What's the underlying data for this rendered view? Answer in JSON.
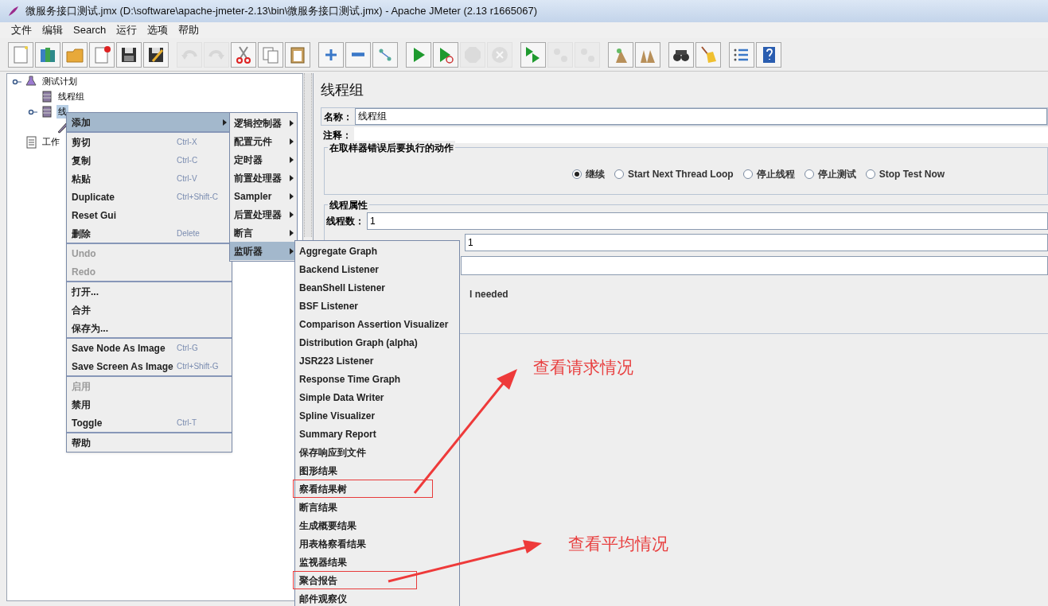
{
  "window": {
    "title": "微服务接口测试.jmx (D:\\software\\apache-jmeter-2.13\\bin\\微服务接口测试.jmx) - Apache JMeter (2.13 r1665067)"
  },
  "menu_bar": [
    "文件",
    "编辑",
    "Search",
    "运行",
    "选项",
    "帮助"
  ],
  "toolbar": [
    [
      {
        "kind": "new",
        "disabled": false
      },
      {
        "kind": "templates",
        "disabled": false
      },
      {
        "kind": "open",
        "disabled": false
      },
      {
        "kind": "close",
        "disabled": false
      },
      {
        "kind": "save",
        "disabled": false
      },
      {
        "kind": "save_as",
        "disabled": false
      }
    ],
    [
      {
        "kind": "undo",
        "disabled": true
      },
      {
        "kind": "redo",
        "disabled": true
      },
      {
        "kind": "cut",
        "disabled": false
      },
      {
        "kind": "copy",
        "disabled": false
      },
      {
        "kind": "paste",
        "disabled": false
      }
    ],
    [
      {
        "kind": "expand",
        "disabled": false
      },
      {
        "kind": "collapse",
        "disabled": false
      },
      {
        "kind": "toggle",
        "disabled": false
      }
    ],
    [
      {
        "kind": "start",
        "disabled": false
      },
      {
        "kind": "start_no_pause",
        "disabled": false
      },
      {
        "kind": "stop",
        "disabled": true
      },
      {
        "kind": "shutdown",
        "disabled": true
      }
    ],
    [
      {
        "kind": "remote_start",
        "disabled": false
      },
      {
        "kind": "remote_stop",
        "disabled": true
      },
      {
        "kind": "remote_shutdown",
        "disabled": true
      }
    ],
    [
      {
        "kind": "clear",
        "disabled": false
      },
      {
        "kind": "clear_all",
        "disabled": false
      }
    ],
    [
      {
        "kind": "search",
        "disabled": false
      },
      {
        "kind": "reset_search",
        "disabled": false
      }
    ],
    [
      {
        "kind": "functions",
        "disabled": false
      },
      {
        "kind": "help",
        "disabled": false
      }
    ]
  ],
  "tree": [
    {
      "label": "测试计划",
      "kind": "plan",
      "selected": false,
      "children": [
        {
          "label": "线程组",
          "kind": "thread",
          "selected": false
        },
        {
          "label": "线",
          "kind": "thread",
          "selected": true,
          "children": [
            {
              "kind": "sampler"
            }
          ]
        }
      ]
    },
    {
      "label": "工作",
      "kind": "workbench",
      "selected": false
    }
  ],
  "context_menu": [
    [
      {
        "label": "添加",
        "selected": true,
        "submenu": true,
        "disabled": false
      }
    ],
    [
      {
        "label": "剪切",
        "shortcut": "Ctrl-X",
        "selected": false,
        "submenu": false,
        "disabled": false
      },
      {
        "label": "复制",
        "shortcut": "Ctrl-C",
        "selected": false,
        "submenu": false,
        "disabled": false
      },
      {
        "label": "粘贴",
        "shortcut": "Ctrl-V",
        "selected": false,
        "submenu": false,
        "disabled": false
      },
      {
        "label": "Duplicate",
        "shortcut": "Ctrl+Shift-C",
        "selected": false,
        "submenu": false,
        "disabled": false
      },
      {
        "label": "Reset Gui",
        "selected": false,
        "submenu": false,
        "disabled": false
      },
      {
        "label": "删除",
        "shortcut": "Delete",
        "selected": false,
        "submenu": false,
        "disabled": false
      }
    ],
    [
      {
        "label": "Undo",
        "selected": false,
        "submenu": false,
        "disabled": true
      },
      {
        "label": "Redo",
        "selected": false,
        "submenu": false,
        "disabled": true
      }
    ],
    [
      {
        "label": "打开...",
        "selected": false,
        "submenu": false,
        "disabled": false
      },
      {
        "label": "合并",
        "selected": false,
        "submenu": false,
        "disabled": false
      },
      {
        "label": "保存为...",
        "selected": false,
        "submenu": false,
        "disabled": false
      }
    ],
    [
      {
        "label": "Save Node As Image",
        "shortcut": "Ctrl-G",
        "selected": false,
        "submenu": false,
        "disabled": false
      },
      {
        "label": "Save Screen As Image",
        "shortcut": "Ctrl+Shift-G",
        "selected": false,
        "submenu": false,
        "disabled": false
      }
    ],
    [
      {
        "label": "启用",
        "selected": false,
        "submenu": false,
        "disabled": true
      },
      {
        "label": "禁用",
        "selected": false,
        "submenu": false,
        "disabled": false
      },
      {
        "label": "Toggle",
        "shortcut": "Ctrl-T",
        "selected": false,
        "submenu": false,
        "disabled": false
      }
    ],
    [
      {
        "label": "帮助",
        "selected": false,
        "submenu": false,
        "disabled": false
      }
    ]
  ],
  "add_submenu": [
    {
      "label": "逻辑控制器",
      "selected": false
    },
    {
      "label": "配置元件",
      "selected": false
    },
    {
      "label": "定时器",
      "selected": false
    },
    {
      "label": "前置处理器",
      "selected": false
    },
    {
      "label": "Sampler",
      "selected": false
    },
    {
      "label": "后置处理器",
      "selected": false
    },
    {
      "label": "断言",
      "selected": false
    },
    {
      "label": "监听器",
      "selected": true
    }
  ],
  "listener_submenu": [
    {
      "label": "Aggregate Graph",
      "highlighted": false
    },
    {
      "label": "Backend Listener",
      "highlighted": false
    },
    {
      "label": "BeanShell Listener",
      "highlighted": false
    },
    {
      "label": "BSF Listener",
      "highlighted": false
    },
    {
      "label": "Comparison Assertion Visualizer",
      "highlighted": false
    },
    {
      "label": "Distribution Graph (alpha)",
      "highlighted": false
    },
    {
      "label": "JSR223 Listener",
      "highlighted": false
    },
    {
      "label": "Response Time Graph",
      "highlighted": false
    },
    {
      "label": "Simple Data Writer",
      "highlighted": false
    },
    {
      "label": "Spline Visualizer",
      "highlighted": false
    },
    {
      "label": "Summary Report",
      "highlighted": false
    },
    {
      "label": "保存响应到文件",
      "highlighted": false
    },
    {
      "label": "图形结果",
      "highlighted": false
    },
    {
      "label": "察看结果树",
      "highlighted": true
    },
    {
      "label": "断言结果",
      "highlighted": false
    },
    {
      "label": "生成概要结果",
      "highlighted": false
    },
    {
      "label": "用表格察看结果",
      "highlighted": false
    },
    {
      "label": "监视器结果",
      "highlighted": false
    },
    {
      "label": "聚合报告",
      "highlighted": true
    },
    {
      "label": "邮件观察仪",
      "highlighted": false
    }
  ],
  "panel": {
    "title": "线程组",
    "name_label": "名称：",
    "name_value": "线程组",
    "comment_label": "注释：",
    "error_action": {
      "legend": "在取样器错误后要执行的动作",
      "options": [
        {
          "label": "继续",
          "selected": true
        },
        {
          "label": "Start Next Thread Loop",
          "selected": false
        },
        {
          "label": "停止线程",
          "selected": false
        },
        {
          "label": "停止测试",
          "selected": false
        },
        {
          "label": "Stop Test Now",
          "selected": false
        }
      ]
    },
    "thread_properties": {
      "legend": "线程属性",
      "threads_label": "线程数：",
      "threads_value": "1",
      "ramp_up_value": "1",
      "delay_fragment": "l needed"
    }
  },
  "annotations": [
    {
      "text": "查看请求情况"
    },
    {
      "text": "查看平均情况"
    }
  ]
}
